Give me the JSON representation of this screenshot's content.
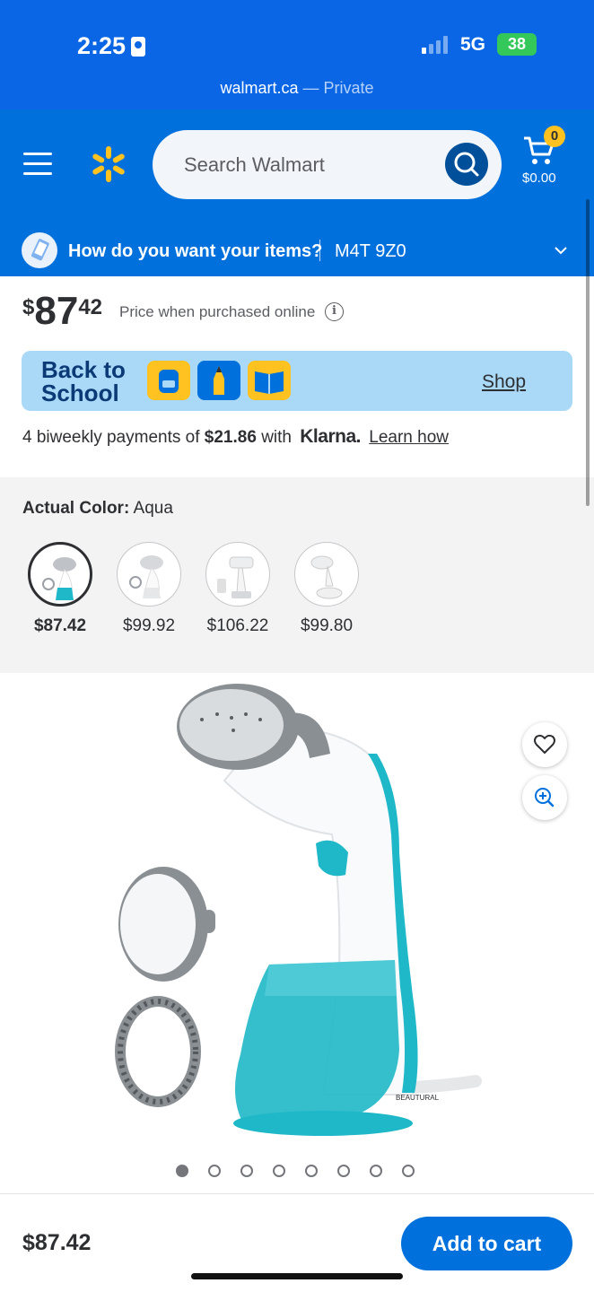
{
  "status_bar": {
    "time": "2:25",
    "network": "5G",
    "battery": "38"
  },
  "browser": {
    "domain": "walmart.ca",
    "mode": "— Private"
  },
  "header": {
    "search_placeholder": "Search Walmart",
    "cart_count": "0",
    "cart_total": "$0.00"
  },
  "delivery": {
    "question": "How do you want your items?",
    "postal_code": "M4T 9Z0"
  },
  "price": {
    "currency": "$",
    "dollars": "87",
    "cents": "42",
    "note": "Price when purchased online",
    "info_icon": "i"
  },
  "promo": {
    "title": "Back to School",
    "link": "Shop"
  },
  "klarna": {
    "prefix": "4 biweekly payments of",
    "amount": "$21.86",
    "with": "with",
    "brand": "Klarna.",
    "link": "Learn how"
  },
  "variants": {
    "label": "Actual Color:",
    "selected_color": "Aqua",
    "options": [
      {
        "price": "$87.42"
      },
      {
        "price": "$99.92"
      },
      {
        "price": "$106.22"
      },
      {
        "price": "$99.80"
      }
    ]
  },
  "gallery": {
    "image_count": 8,
    "active_index": 0,
    "product_brand_text": "BEAUTURAL"
  },
  "bottom_bar": {
    "price": "$87.42",
    "add_to_cart": "Add to cart"
  },
  "colors": {
    "walmart_blue": "#0071dc",
    "spark_yellow": "#ffc220",
    "aqua": "#1fb8c8"
  }
}
